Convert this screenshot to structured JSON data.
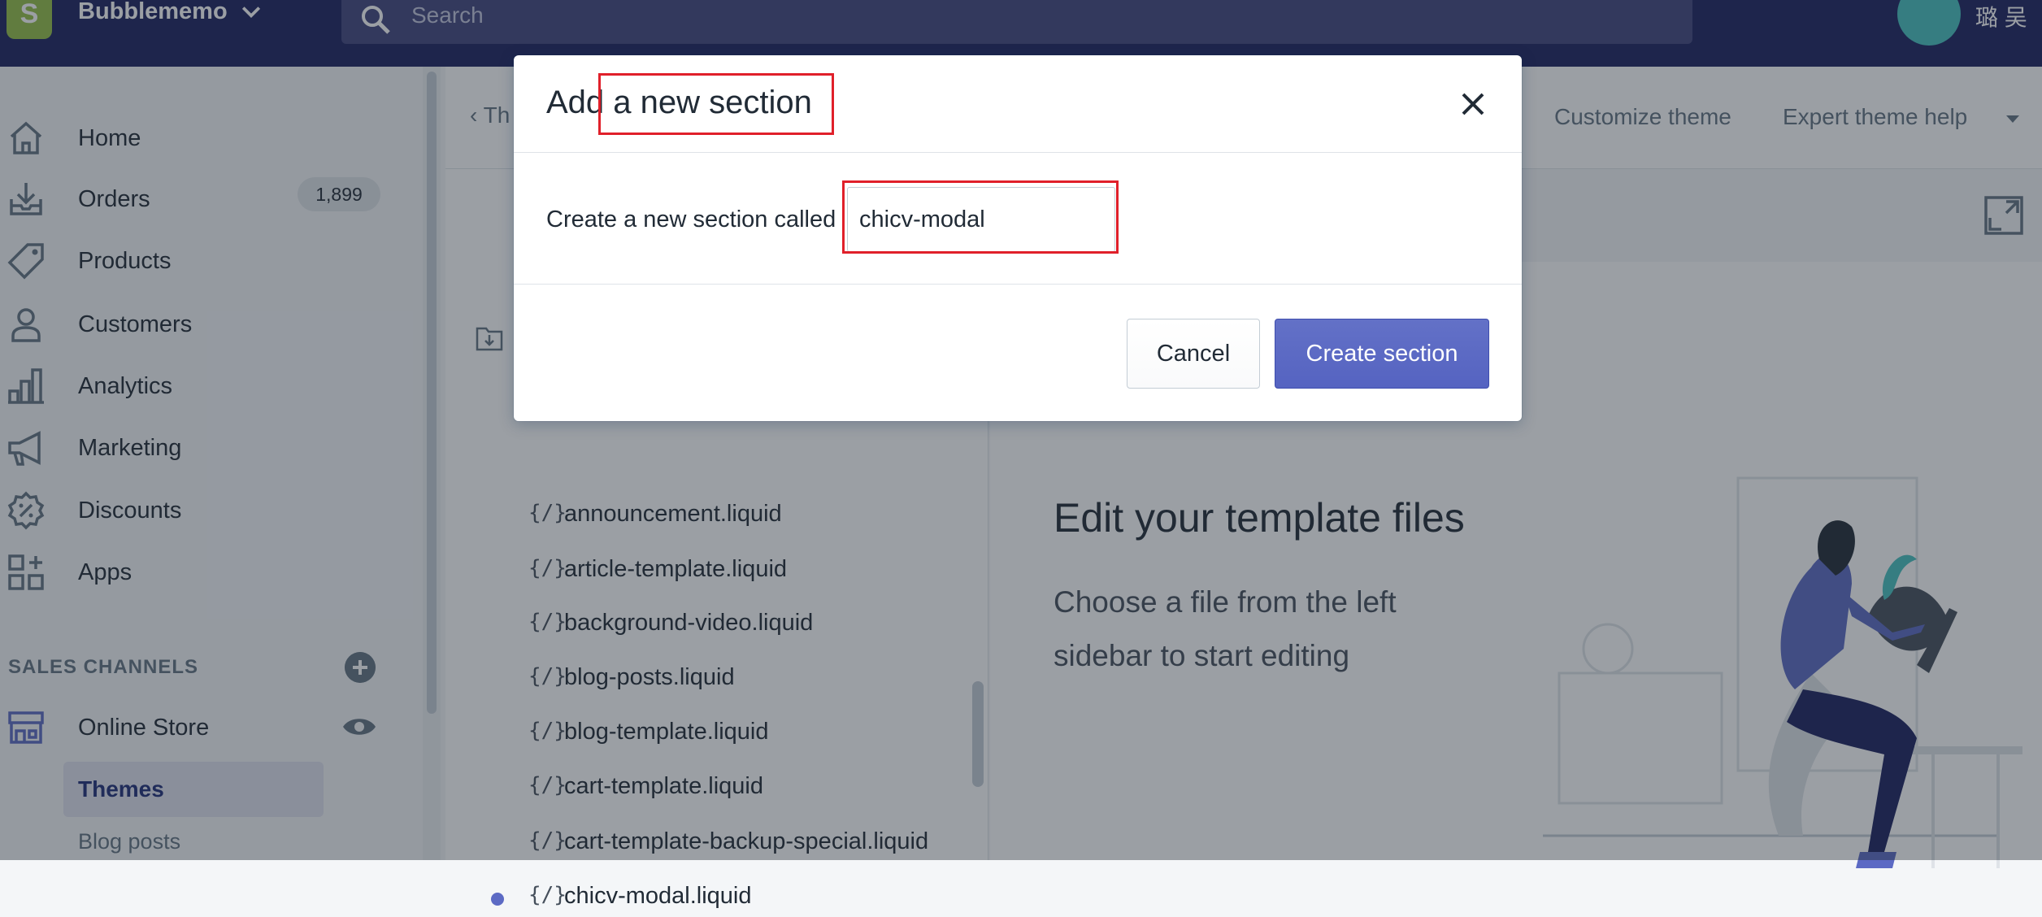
{
  "topbar": {
    "store_name": "Bubblememo",
    "logo_letter": "S",
    "search_placeholder": "Search",
    "user_name": "璐 吴"
  },
  "sidebar": {
    "items": [
      {
        "label": "Home",
        "icon": "home-icon"
      },
      {
        "label": "Orders",
        "icon": "orders-icon",
        "badge": "1,899"
      },
      {
        "label": "Products",
        "icon": "tag-icon"
      },
      {
        "label": "Customers",
        "icon": "person-icon"
      },
      {
        "label": "Analytics",
        "icon": "bar-chart-icon"
      },
      {
        "label": "Marketing",
        "icon": "megaphone-icon"
      },
      {
        "label": "Discounts",
        "icon": "discount-icon"
      },
      {
        "label": "Apps",
        "icon": "apps-icon"
      }
    ],
    "channels_title": "SALES CHANNELS",
    "online_store": "Online Store",
    "themes": "Themes",
    "blog_posts": "Blog posts"
  },
  "header": {
    "back": "Th",
    "customize": "Customize theme",
    "expert_help": "Expert theme help"
  },
  "files": [
    {
      "glyph": "{/}",
      "name": "announcement.liquid"
    },
    {
      "glyph": "{/}",
      "name": "article-template.liquid"
    },
    {
      "glyph": "{/}",
      "name": "background-video.liquid"
    },
    {
      "glyph": "{/}",
      "name": "blog-posts.liquid"
    },
    {
      "glyph": "{/}",
      "name": "blog-template.liquid"
    },
    {
      "glyph": "{/}",
      "name": "cart-template.liquid"
    },
    {
      "glyph": "{/}",
      "name": "cart-template-backup-special.liquid"
    },
    {
      "glyph": "{/}",
      "name": "chicv-modal.liquid",
      "dot": true
    }
  ],
  "preview": {
    "title": "Edit your template files",
    "description": "Choose a file from the left sidebar to start editing"
  },
  "modal": {
    "title": "Add a new section",
    "field_label": "Create a new section called",
    "field_value": "chicv-modal",
    "cancel": "Cancel",
    "create": "Create section"
  },
  "colors": {
    "topbar": "#1c2260",
    "primary": "#5c6ac4",
    "highlight": "#e0202a"
  }
}
